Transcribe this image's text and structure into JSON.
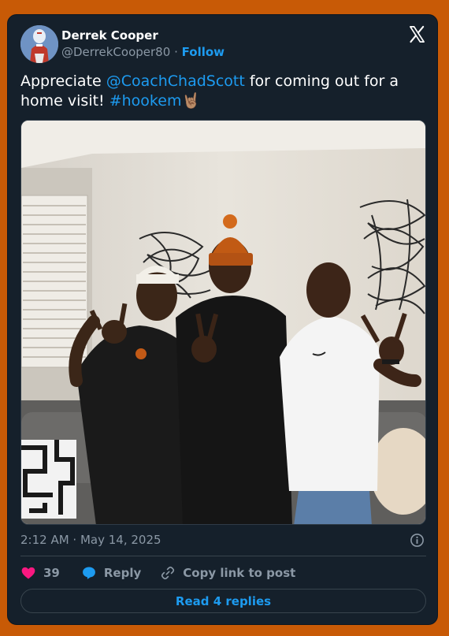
{
  "author": {
    "name": "Derrek Cooper",
    "handle": "@DerrekCooper80",
    "separator": "·",
    "follow_label": "Follow"
  },
  "tweet": {
    "text_before": "Appreciate ",
    "mention": "@CoachChadScott",
    "text_middle": " for coming out for a home visit! ",
    "hashtag": "#hookem",
    "emoji": "🤘🏽"
  },
  "meta": {
    "timestamp": "2:12 AM · May 14, 2025"
  },
  "actions": {
    "likes": "39",
    "reply_label": "Reply",
    "copy_label": "Copy link to post"
  },
  "read_replies_label": "Read 4 replies",
  "colors": {
    "page_bg": "#c85a06",
    "card_bg": "#15202b",
    "accent": "#1d9bf0",
    "like": "#f91880",
    "muted": "#8b98a5"
  },
  "icons": [
    "x-logo-icon",
    "info-icon",
    "heart-icon",
    "reply-bubble-icon",
    "link-icon"
  ]
}
